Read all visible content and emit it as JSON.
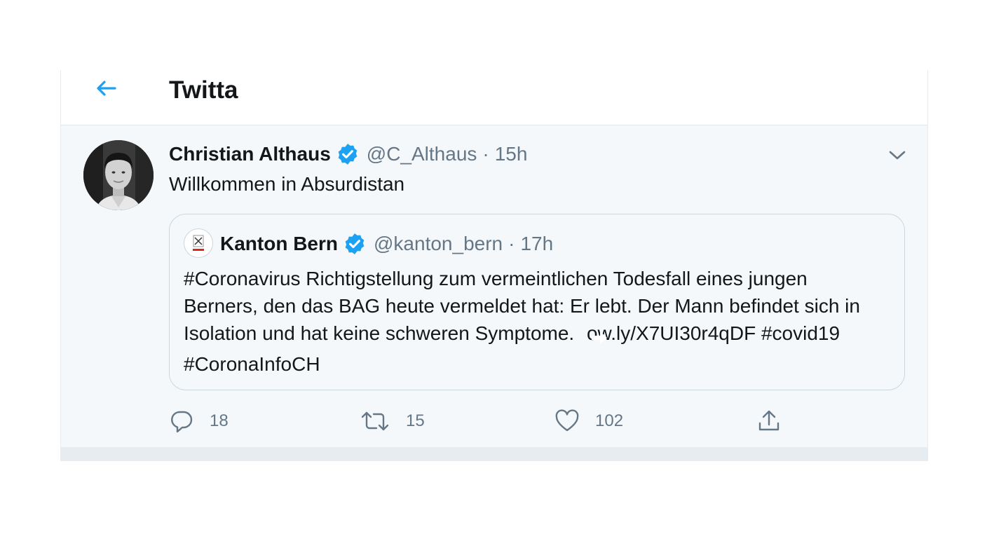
{
  "header": {
    "title": "Twitta"
  },
  "tweet": {
    "author_name": "Christian Althaus",
    "author_handle": "@C_Althaus",
    "separator": "·",
    "time": "15h",
    "text": "Willkommen in Absurdistan"
  },
  "quote": {
    "author_name": "Kanton Bern",
    "author_handle": "@kanton_bern",
    "separator": "·",
    "time": "17h",
    "text_part1": "#Coronavirus Richtigstellung zum vermeintlichen Todesfall eines jungen Berners, den das BAG heute vermeldet hat: Er lebt. Der Mann befindet sich in Isolation und hat keine schweren Symptome.",
    "text_part2": "ow.ly/X7UI30r4qDF #covid19 #CoronaInfoCH"
  },
  "actions": {
    "reply_count": "18",
    "retweet_count": "15",
    "like_count": "102"
  },
  "colors": {
    "accent": "#1da1f2",
    "secondary_text": "#657786",
    "panel_bg": "#f5f8fa"
  },
  "icons": [
    "back-arrow-icon",
    "verified-badge-icon",
    "chevron-down-icon",
    "reply-icon",
    "retweet-icon",
    "like-icon",
    "share-icon",
    "arrow-right-emoji-icon"
  ]
}
